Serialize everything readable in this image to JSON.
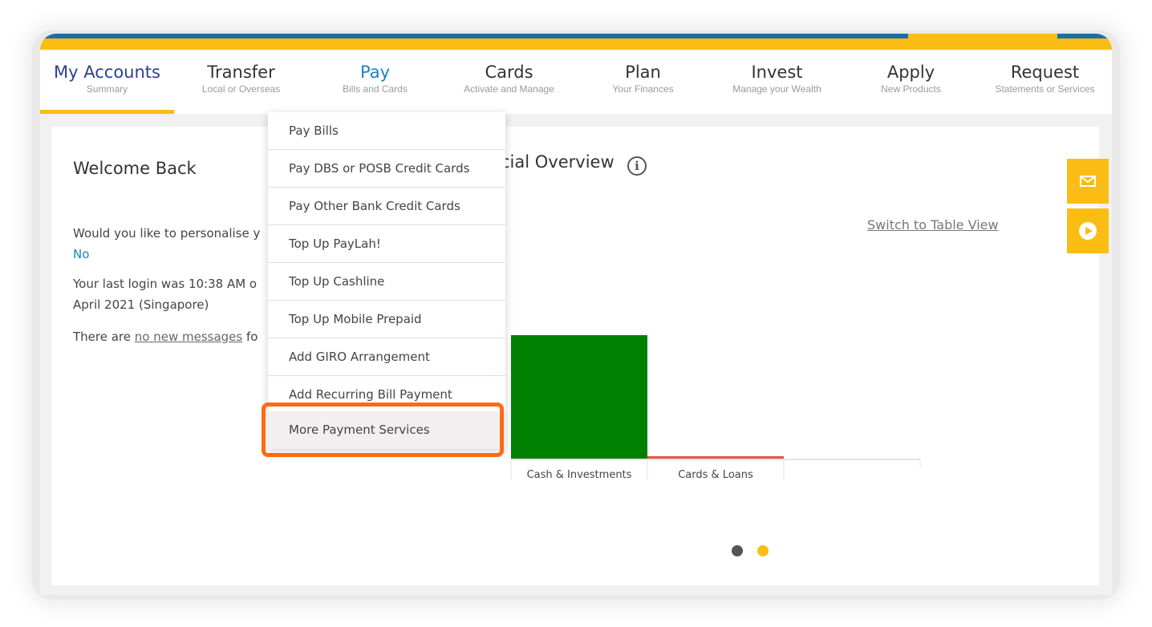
{
  "nav": {
    "items": [
      {
        "title": "My Accounts",
        "sub": "Summary"
      },
      {
        "title": "Transfer",
        "sub": "Local or Overseas"
      },
      {
        "title": "Pay",
        "sub": "Bills and Cards"
      },
      {
        "title": "Cards",
        "sub": "Activate and Manage"
      },
      {
        "title": "Plan",
        "sub": "Your Finances"
      },
      {
        "title": "Invest",
        "sub": "Manage your Wealth"
      },
      {
        "title": "Apply",
        "sub": "New Products"
      },
      {
        "title": "Request",
        "sub": "Statements or Services"
      }
    ],
    "active_index": 0,
    "open_index": 2
  },
  "welcome": {
    "title": "Welcome Back",
    "personalise_text": "Would you like to personalise y",
    "no_link": "No",
    "last_login_line1": "Your last login was 10:38 AM o",
    "last_login_line2": "April 2021 (Singapore)",
    "messages_prefix": "There are ",
    "messages_link": "no new messages",
    "messages_suffix": " fo"
  },
  "overview": {
    "title": "cial Overview",
    "info_icon": "i",
    "switch_link": "Switch to Table View"
  },
  "chart_data": {
    "type": "bar",
    "categories": [
      "Cash & Investments",
      "Cards & Loans"
    ],
    "values": [
      1.0,
      0.02
    ],
    "colors": [
      "#008000",
      "#e8544a"
    ],
    "ylim": [
      0,
      1
    ],
    "grid": false
  },
  "pay_menu": {
    "items": [
      "Pay Bills",
      "Pay DBS or POSB Credit Cards",
      "Pay Other Bank Credit Cards",
      "Top Up PayLah!",
      "Top Up Cashline",
      "Top Up Mobile Prepaid",
      "Add GIRO Arrangement",
      "Add Recurring Bill Payment",
      "More Payment Services"
    ],
    "highlighted_index": 8
  },
  "carousel": {
    "dots": 2,
    "active_index": 1
  },
  "side_buttons": [
    "mail-icon",
    "play-icon"
  ],
  "colors": {
    "brand_gold": "#fbbd13",
    "brand_blue": "#1b6fa5",
    "highlight_orange": "#ff6a13",
    "link_blue": "#1b82c5"
  }
}
